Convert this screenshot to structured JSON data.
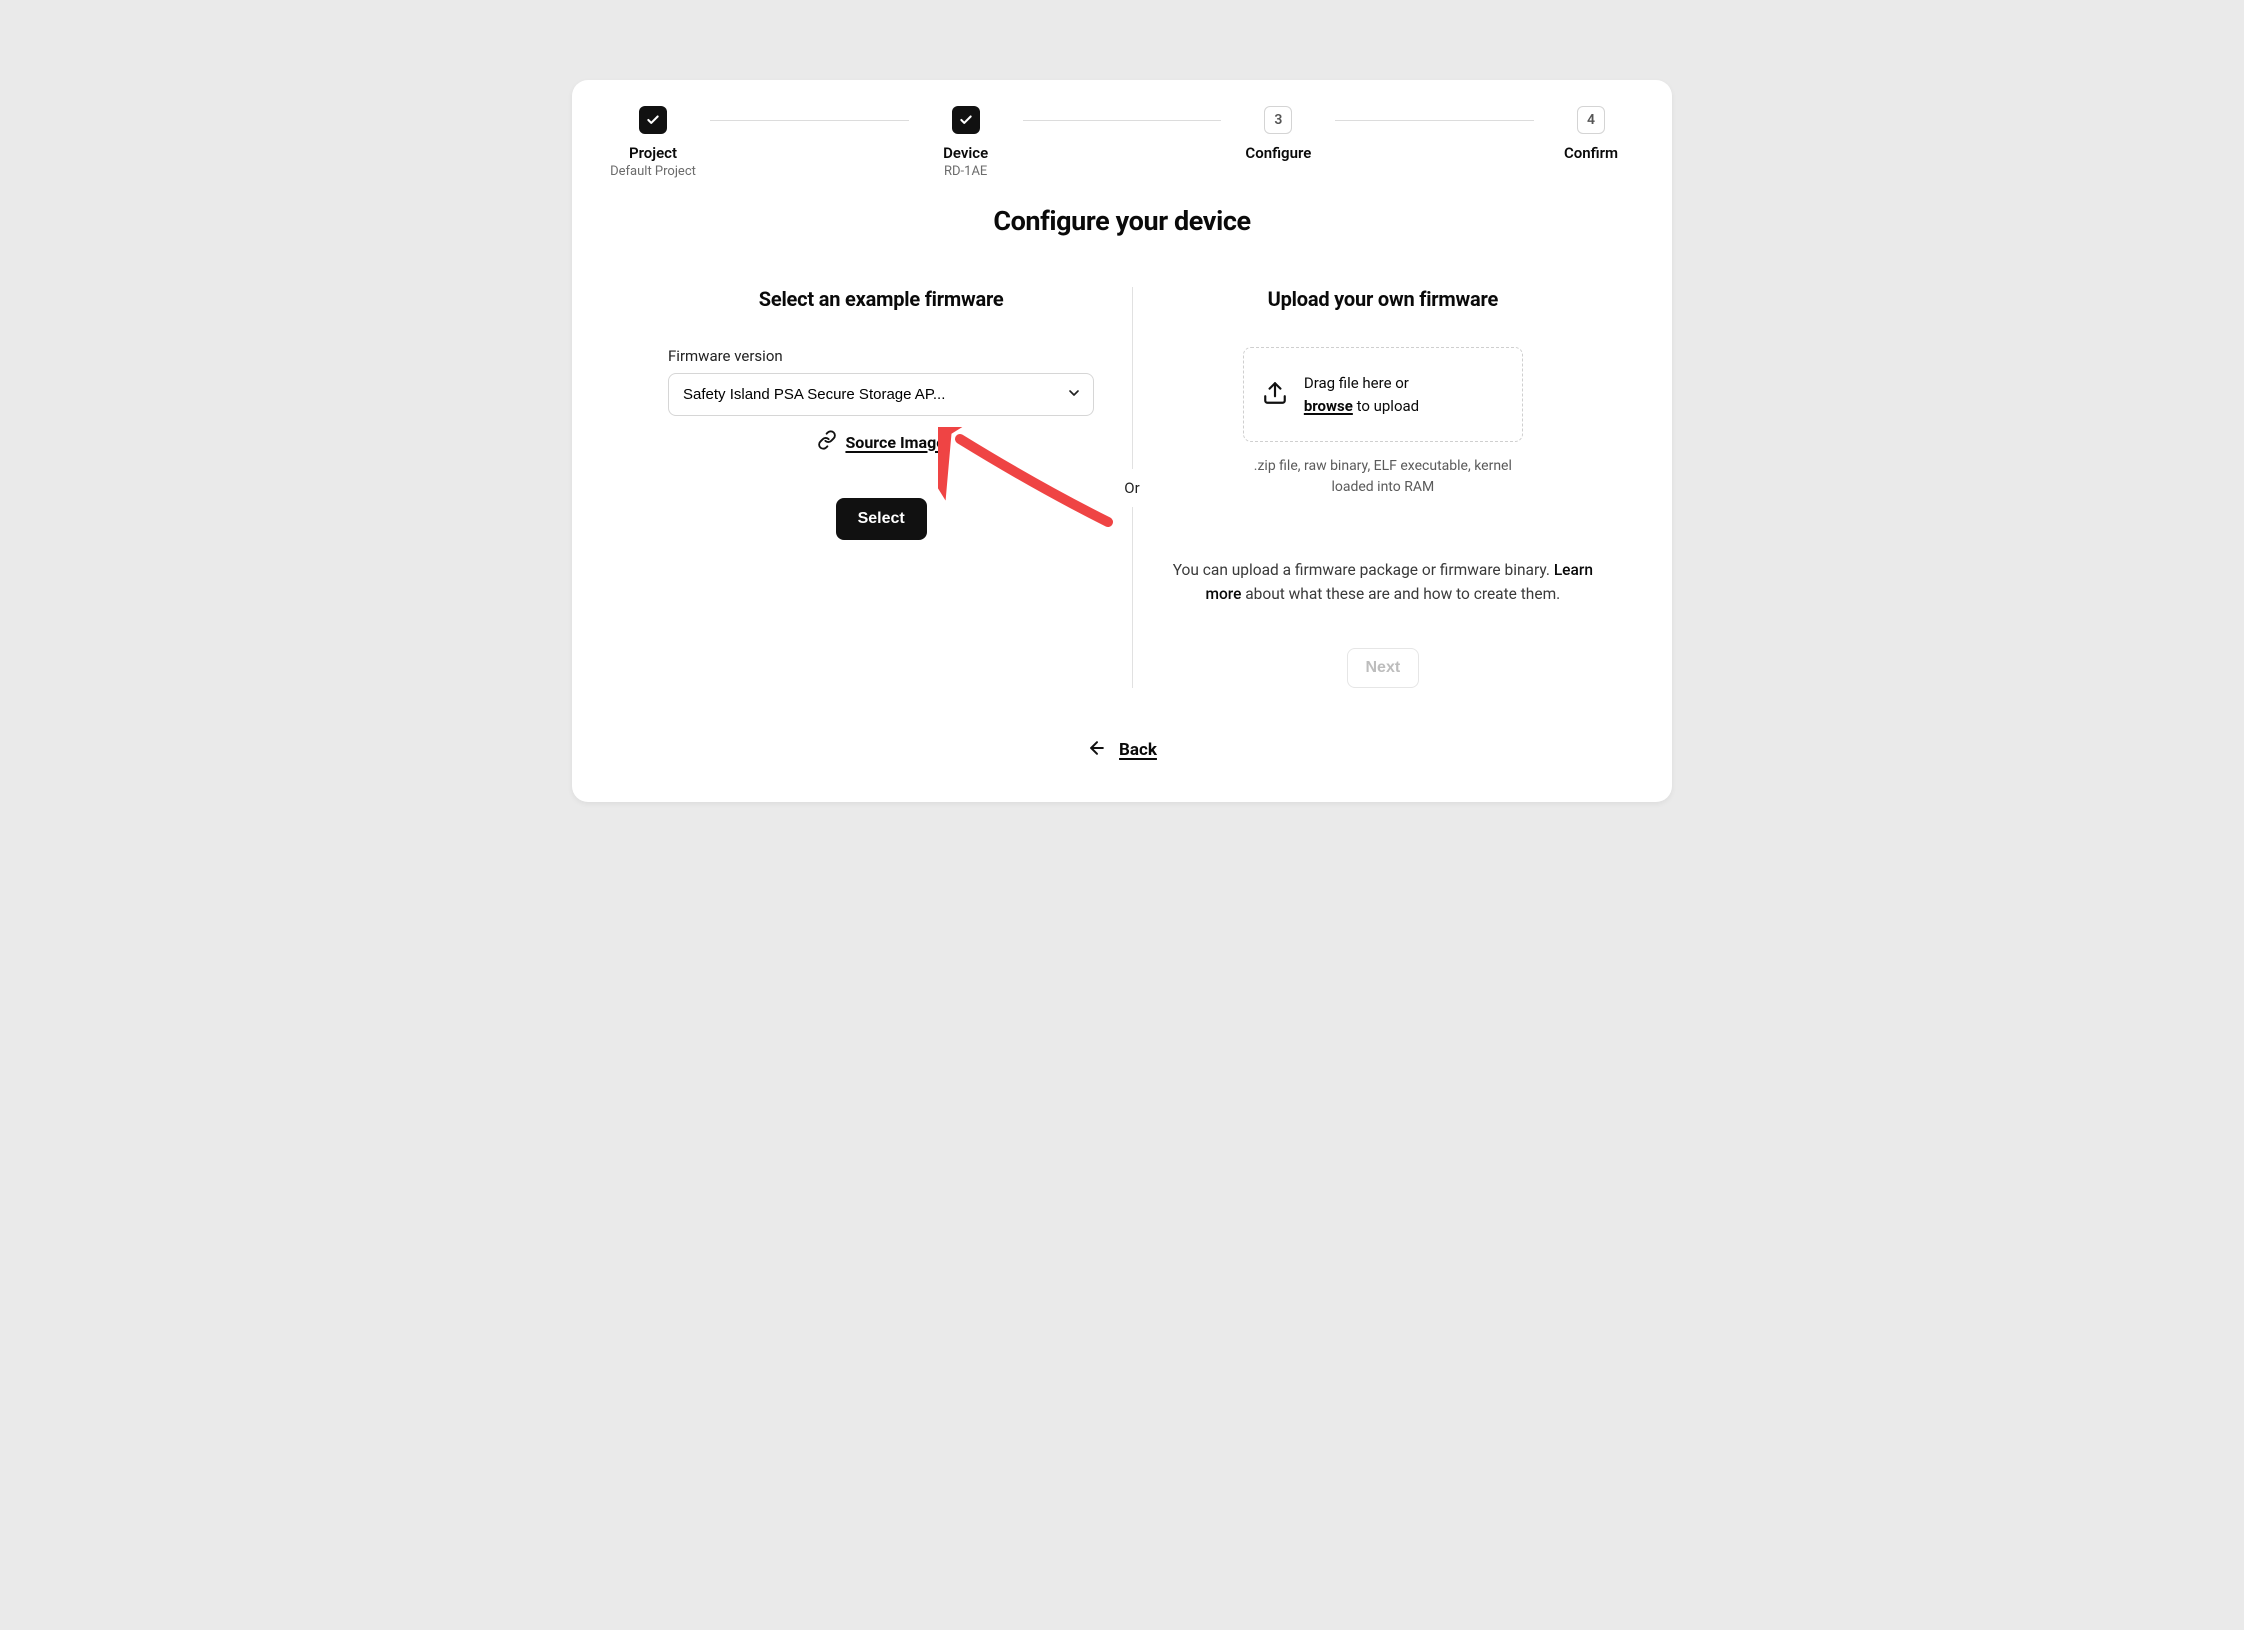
{
  "stepper": {
    "steps": [
      {
        "label": "Project",
        "sub": "Default Project",
        "done": true
      },
      {
        "label": "Device",
        "sub": "RD-1AE",
        "done": true
      },
      {
        "label": "Configure",
        "sub": "",
        "number": "3"
      },
      {
        "label": "Confirm",
        "sub": "",
        "number": "4"
      }
    ]
  },
  "title": "Configure your device",
  "left": {
    "heading": "Select an example firmware",
    "field_label": "Firmware version",
    "selected": "Safety Island PSA Secure Storage AP...",
    "source_link": "Source Image",
    "select_button": "Select"
  },
  "divider_label": "Or",
  "right": {
    "heading": "Upload your own firmware",
    "drop_line1": "Drag file here or",
    "drop_browse": "browse",
    "drop_line2": " to upload",
    "hint": ".zip file, raw binary, ELF executable, kernel loaded into RAM",
    "desc_pre": "You can upload a firmware package or firmware binary. ",
    "desc_learn": "Learn more",
    "desc_post": " about what these are and how to create them.",
    "next_button": "Next"
  },
  "back_label": "Back"
}
